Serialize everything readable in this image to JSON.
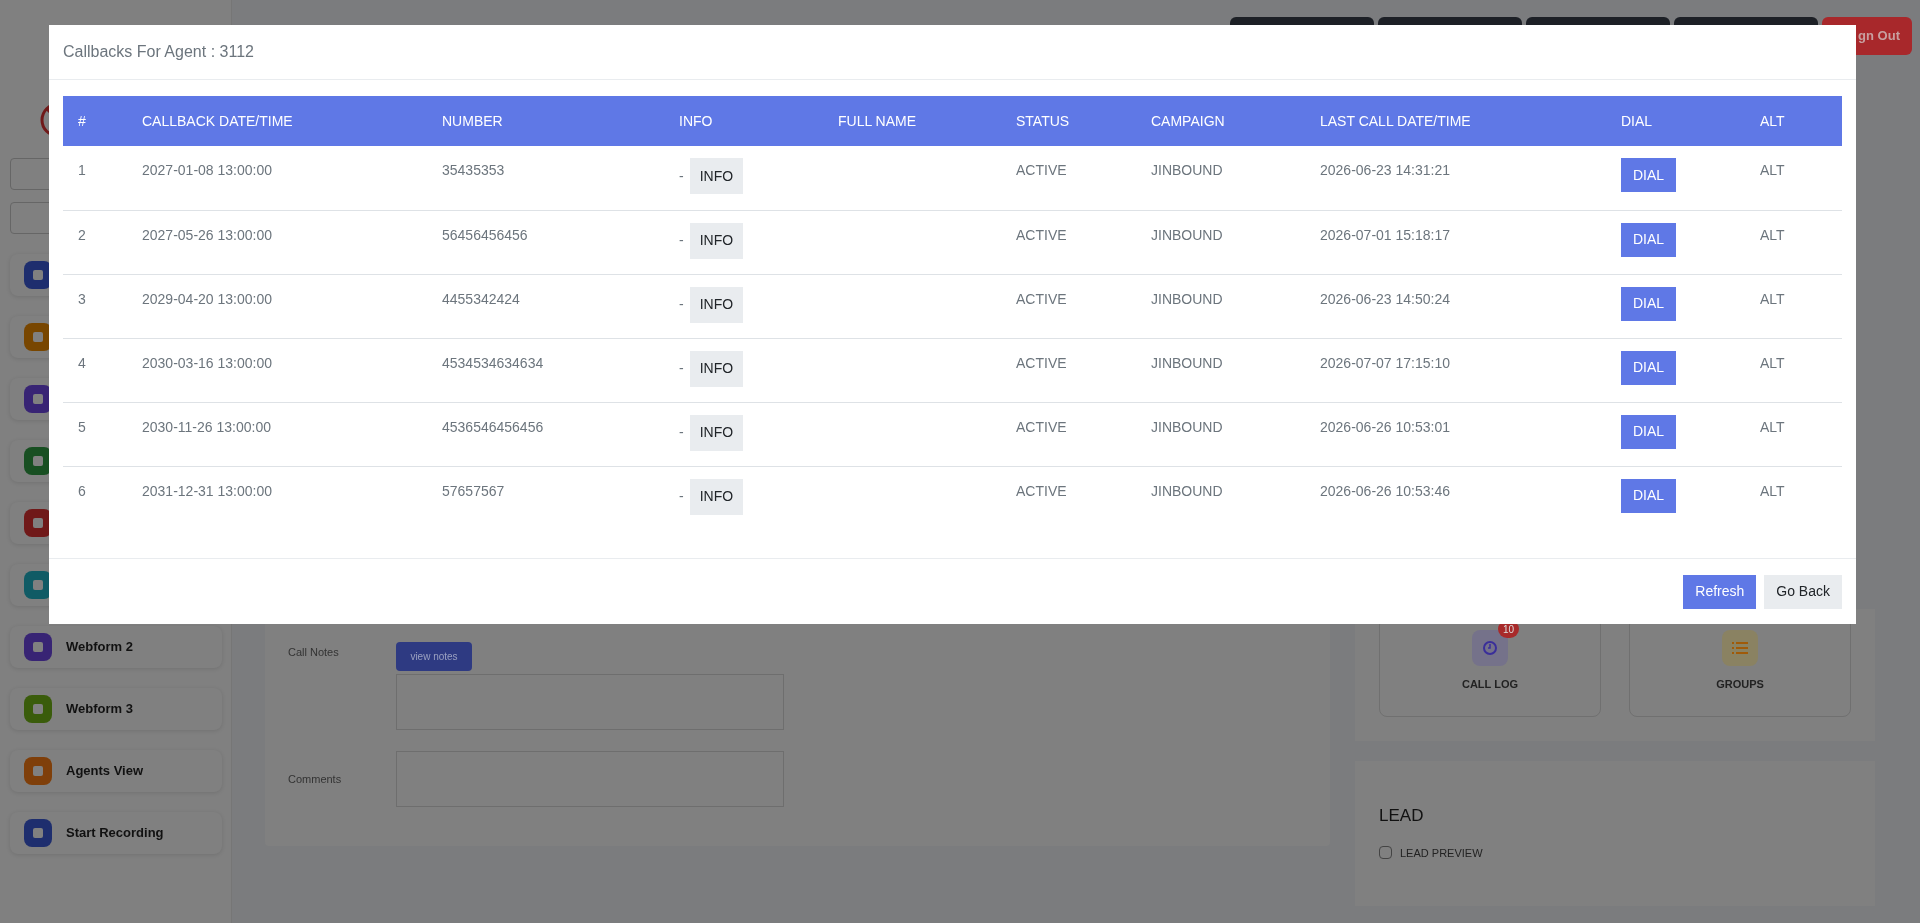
{
  "top_bar": {
    "buttons": [
      {
        "kind": "dark"
      },
      {
        "kind": "dark"
      },
      {
        "kind": "dark"
      },
      {
        "kind": "dark"
      },
      {
        "kind": "danger",
        "label": "gn Out"
      }
    ]
  },
  "sidebar": {
    "fields": [
      {
        "kind": "field"
      },
      {
        "kind": "field"
      }
    ],
    "items": [
      {
        "color": "#1e2e6e"
      },
      {
        "color": "#784600"
      },
      {
        "color": "#382474"
      },
      {
        "color": "#184f22"
      },
      {
        "color": "#701919"
      },
      {
        "color": "#105b65"
      },
      {
        "label": "Webform 2",
        "color": "#382474"
      },
      {
        "label": "Webform 3",
        "color": "#3a5c0b"
      },
      {
        "label": "Agents View",
        "color": "#7f3f0a"
      },
      {
        "label": "Start Recording",
        "color": "#1e2e6e"
      }
    ]
  },
  "notes_panel": {
    "call_notes_label": "Call Notes",
    "view_notes_button": "view notes",
    "comments_label": "Comments"
  },
  "tiles": [
    {
      "label": "CALL LOG",
      "badge": "10",
      "kind": "clock"
    },
    {
      "label": "GROUPS",
      "kind": "list"
    }
  ],
  "lead": {
    "title": "LEAD",
    "preview_label": "LEAD PREVIEW",
    "checked": false
  },
  "modal": {
    "title": "Callbacks For Agent : 3112",
    "columns": [
      "#",
      "CALLBACK DATE/TIME",
      "NUMBER",
      "INFO",
      "FULL NAME",
      "STATUS",
      "CAMPAIGN",
      "LAST CALL DATE/TIME",
      "DIAL",
      "ALT"
    ],
    "rows": [
      {
        "index": "1",
        "callback": "2027-01-08 13:00:00",
        "number": "35435353",
        "info_prefix": "-",
        "info_button": "INFO",
        "status": "ACTIVE",
        "campaign": "JINBOUND",
        "last_call": "2026-06-23 14:31:21",
        "dial": "DIAL",
        "alt": "ALT"
      },
      {
        "index": "2",
        "callback": "2027-05-26 13:00:00",
        "number": "56456456456",
        "info_prefix": "-",
        "info_button": "INFO",
        "status": "ACTIVE",
        "campaign": "JINBOUND",
        "last_call": "2026-07-01 15:18:17",
        "dial": "DIAL",
        "alt": "ALT"
      },
      {
        "index": "3",
        "callback": "2029-04-20 13:00:00",
        "number": "4455342424",
        "info_prefix": "-",
        "info_button": "INFO",
        "status": "ACTIVE",
        "campaign": "JINBOUND",
        "last_call": "2026-06-23 14:50:24",
        "dial": "DIAL",
        "alt": "ALT"
      },
      {
        "index": "4",
        "callback": "2030-03-16 13:00:00",
        "number": "4534534634634",
        "info_prefix": "-",
        "info_button": "INFO",
        "status": "ACTIVE",
        "campaign": "JINBOUND",
        "last_call": "2026-07-07 17:15:10",
        "dial": "DIAL",
        "alt": "ALT"
      },
      {
        "index": "5",
        "callback": "2030-11-26 13:00:00",
        "number": "4536546456456",
        "info_prefix": "-",
        "info_button": "INFO",
        "status": "ACTIVE",
        "campaign": "JINBOUND",
        "last_call": "2026-06-26 10:53:01",
        "dial": "DIAL",
        "alt": "ALT"
      },
      {
        "index": "6",
        "callback": "2031-12-31 13:00:00",
        "number": "57657567",
        "info_prefix": "-",
        "info_button": "INFO",
        "status": "ACTIVE",
        "campaign": "JINBOUND",
        "last_call": "2026-06-26 10:53:46",
        "dial": "DIAL",
        "alt": "ALT"
      }
    ],
    "footer_buttons": [
      {
        "label": "Refresh",
        "kind": "primary"
      },
      {
        "label": "Go Back",
        "kind": "secondary"
      }
    ]
  }
}
